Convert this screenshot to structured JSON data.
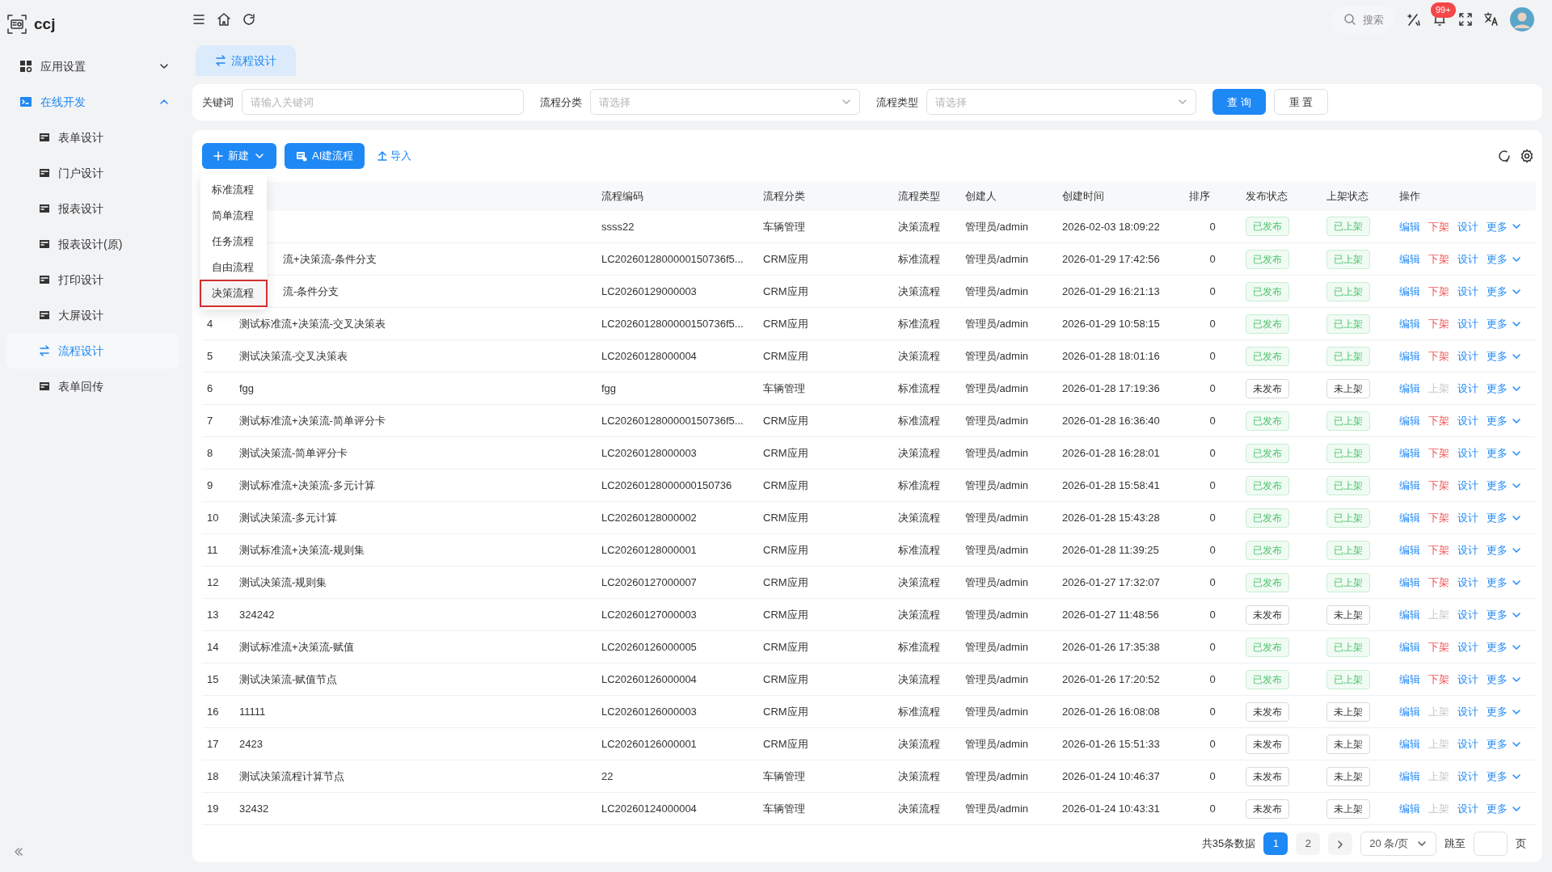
{
  "brand": {
    "name": "ccj"
  },
  "header": {
    "search_label": "搜索",
    "notification_badge": "99+"
  },
  "sidebar": {
    "items": [
      {
        "label": "应用设置",
        "expanded": false,
        "active": false
      },
      {
        "label": "在线开发",
        "expanded": true,
        "active": true,
        "children": [
          {
            "label": "表单设计",
            "selected": false
          },
          {
            "label": "门户设计",
            "selected": false
          },
          {
            "label": "报表设计",
            "selected": false
          },
          {
            "label": "报表设计(原)",
            "selected": false
          },
          {
            "label": "打印设计",
            "selected": false
          },
          {
            "label": "大屏设计",
            "selected": false
          },
          {
            "label": "流程设计",
            "selected": true
          },
          {
            "label": "表单回传",
            "selected": false
          }
        ]
      }
    ]
  },
  "tabs": [
    {
      "label": "流程设计",
      "selected": true
    }
  ],
  "filters": [
    {
      "kind": "text",
      "label": "关键词",
      "placeholder": "请输入关键词"
    },
    {
      "kind": "select",
      "label": "流程分类",
      "placeholder": "请选择"
    },
    {
      "kind": "select",
      "label": "流程类型",
      "placeholder": "请选择"
    }
  ],
  "filter_buttons": [
    {
      "label": "查 询",
      "kind": "primary"
    },
    {
      "label": "重 置",
      "kind": "default"
    }
  ],
  "toolbar": {
    "new_button": "新建",
    "ai_button": "AI建流程",
    "import_link": "导入"
  },
  "new_menu": [
    {
      "label": "标准流程",
      "highlighted": false
    },
    {
      "label": "简单流程",
      "highlighted": false
    },
    {
      "label": "任务流程",
      "highlighted": false
    },
    {
      "label": "自由流程",
      "highlighted": false
    },
    {
      "label": "决策流程",
      "highlighted": true
    }
  ],
  "table": {
    "columns": [
      "流程编码",
      "流程分类",
      "流程类型",
      "创建人",
      "创建时间",
      "排序",
      "发布状态",
      "上架状态",
      "操作"
    ],
    "rows": [
      {
        "code": "ssss22",
        "category": "车辆管理",
        "type": "决策流程",
        "creator": "管理员/admin",
        "created": "2026-02-03 18:09:22",
        "sort": "0",
        "publish": "已发布",
        "published": true,
        "listing": "已上架",
        "listed": true,
        "actions": [
          "编辑",
          "下架",
          "设计",
          "更多"
        ],
        "toggle_disabled": false
      },
      {
        "name": "流+决策流-条件分支",
        "code": "LC2026012800000150736f5...",
        "category": "CRM应用",
        "type": "标准流程",
        "creator": "管理员/admin",
        "created": "2026-01-29 17:42:56",
        "sort": "0",
        "publish": "已发布",
        "published": true,
        "listing": "已上架",
        "listed": true,
        "actions": [
          "编辑",
          "下架",
          "设计",
          "更多"
        ],
        "toggle_disabled": false
      },
      {
        "name": "流-条件分支",
        "code": "LC20260129000003",
        "category": "CRM应用",
        "type": "决策流程",
        "creator": "管理员/admin",
        "created": "2026-01-29 16:21:13",
        "sort": "0",
        "publish": "已发布",
        "published": true,
        "listing": "已上架",
        "listed": true,
        "actions": [
          "编辑",
          "下架",
          "设计",
          "更多"
        ],
        "toggle_disabled": false
      },
      {
        "index": "4",
        "name": "测试标准流+决策流-交叉决策表",
        "code": "LC2026012800000150736f5...",
        "category": "CRM应用",
        "type": "标准流程",
        "creator": "管理员/admin",
        "created": "2026-01-29 10:58:15",
        "sort": "0",
        "publish": "已发布",
        "published": true,
        "listing": "已上架",
        "listed": true,
        "actions": [
          "编辑",
          "下架",
          "设计",
          "更多"
        ],
        "toggle_disabled": false
      },
      {
        "index": "5",
        "name": "测试决策流-交叉决策表",
        "code": "LC20260128000004",
        "category": "CRM应用",
        "type": "决策流程",
        "creator": "管理员/admin",
        "created": "2026-01-28 18:01:16",
        "sort": "0",
        "publish": "已发布",
        "published": true,
        "listing": "已上架",
        "listed": true,
        "actions": [
          "编辑",
          "下架",
          "设计",
          "更多"
        ],
        "toggle_disabled": false
      },
      {
        "index": "6",
        "name": "fgg",
        "code": "fgg",
        "category": "车辆管理",
        "type": "标准流程",
        "creator": "管理员/admin",
        "created": "2026-01-28 17:19:36",
        "sort": "0",
        "publish": "未发布",
        "published": false,
        "listing": "未上架",
        "listed": false,
        "actions": [
          "编辑",
          "上架",
          "设计",
          "更多"
        ],
        "toggle_disabled": true
      },
      {
        "index": "7",
        "name": "测试标准流+决策流-简单评分卡",
        "code": "LC2026012800000150736f5...",
        "category": "CRM应用",
        "type": "标准流程",
        "creator": "管理员/admin",
        "created": "2026-01-28 16:36:40",
        "sort": "0",
        "publish": "已发布",
        "published": true,
        "listing": "已上架",
        "listed": true,
        "actions": [
          "编辑",
          "下架",
          "设计",
          "更多"
        ],
        "toggle_disabled": false
      },
      {
        "index": "8",
        "name": "测试决策流-简单评分卡",
        "code": "LC20260128000003",
        "category": "CRM应用",
        "type": "决策流程",
        "creator": "管理员/admin",
        "created": "2026-01-28 16:28:01",
        "sort": "0",
        "publish": "已发布",
        "published": true,
        "listing": "已上架",
        "listed": true,
        "actions": [
          "编辑",
          "下架",
          "设计",
          "更多"
        ],
        "toggle_disabled": false
      },
      {
        "index": "9",
        "name": "测试标准流+决策流-多元计算",
        "code": "LC20260128000000150736",
        "category": "CRM应用",
        "type": "标准流程",
        "creator": "管理员/admin",
        "created": "2026-01-28 15:58:41",
        "sort": "0",
        "publish": "已发布",
        "published": true,
        "listing": "已上架",
        "listed": true,
        "actions": [
          "编辑",
          "下架",
          "设计",
          "更多"
        ],
        "toggle_disabled": false
      },
      {
        "index": "10",
        "name": "测试决策流-多元计算",
        "code": "LC20260128000002",
        "category": "CRM应用",
        "type": "决策流程",
        "creator": "管理员/admin",
        "created": "2026-01-28 15:43:28",
        "sort": "0",
        "publish": "已发布",
        "published": true,
        "listing": "已上架",
        "listed": true,
        "actions": [
          "编辑",
          "下架",
          "设计",
          "更多"
        ],
        "toggle_disabled": false
      },
      {
        "index": "11",
        "name": "测试标准流+决策流-规则集",
        "code": "LC20260128000001",
        "category": "CRM应用",
        "type": "标准流程",
        "creator": "管理员/admin",
        "created": "2026-01-28 11:39:25",
        "sort": "0",
        "publish": "已发布",
        "published": true,
        "listing": "已上架",
        "listed": true,
        "actions": [
          "编辑",
          "下架",
          "设计",
          "更多"
        ],
        "toggle_disabled": false
      },
      {
        "index": "12",
        "name": "测试决策流-规则集",
        "code": "LC20260127000007",
        "category": "CRM应用",
        "type": "决策流程",
        "creator": "管理员/admin",
        "created": "2026-01-27 17:32:07",
        "sort": "0",
        "publish": "已发布",
        "published": true,
        "listing": "已上架",
        "listed": true,
        "actions": [
          "编辑",
          "下架",
          "设计",
          "更多"
        ],
        "toggle_disabled": false
      },
      {
        "index": "13",
        "name": "324242",
        "code": "LC20260127000003",
        "category": "CRM应用",
        "type": "决策流程",
        "creator": "管理员/admin",
        "created": "2026-01-27 11:48:56",
        "sort": "0",
        "publish": "未发布",
        "published": false,
        "listing": "未上架",
        "listed": false,
        "actions": [
          "编辑",
          "上架",
          "设计",
          "更多"
        ],
        "toggle_disabled": true
      },
      {
        "index": "14",
        "name": "测试标准流+决策流-赋值",
        "code": "LC20260126000005",
        "category": "CRM应用",
        "type": "标准流程",
        "creator": "管理员/admin",
        "created": "2026-01-26 17:35:38",
        "sort": "0",
        "publish": "已发布",
        "published": true,
        "listing": "已上架",
        "listed": true,
        "actions": [
          "编辑",
          "下架",
          "设计",
          "更多"
        ],
        "toggle_disabled": false
      },
      {
        "index": "15",
        "name": "测试决策流-赋值节点",
        "code": "LC20260126000004",
        "category": "CRM应用",
        "type": "决策流程",
        "creator": "管理员/admin",
        "created": "2026-01-26 17:20:52",
        "sort": "0",
        "publish": "已发布",
        "published": true,
        "listing": "已上架",
        "listed": true,
        "actions": [
          "编辑",
          "下架",
          "设计",
          "更多"
        ],
        "toggle_disabled": false
      },
      {
        "index": "16",
        "name": "11111",
        "code": "LC20260126000003",
        "category": "CRM应用",
        "type": "标准流程",
        "creator": "管理员/admin",
        "created": "2026-01-26 16:08:08",
        "sort": "0",
        "publish": "未发布",
        "published": false,
        "listing": "未上架",
        "listed": false,
        "actions": [
          "编辑",
          "上架",
          "设计",
          "更多"
        ],
        "toggle_disabled": true
      },
      {
        "index": "17",
        "name": "2423",
        "code": "LC20260126000001",
        "category": "CRM应用",
        "type": "决策流程",
        "creator": "管理员/admin",
        "created": "2026-01-26 15:51:33",
        "sort": "0",
        "publish": "未发布",
        "published": false,
        "listing": "未上架",
        "listed": false,
        "actions": [
          "编辑",
          "上架",
          "设计",
          "更多"
        ],
        "toggle_disabled": true
      },
      {
        "index": "18",
        "name": "测试决策流程计算节点",
        "code": "22",
        "category": "车辆管理",
        "type": "决策流程",
        "creator": "管理员/admin",
        "created": "2026-01-24 10:46:37",
        "sort": "0",
        "publish": "未发布",
        "published": false,
        "listing": "未上架",
        "listed": false,
        "actions": [
          "编辑",
          "上架",
          "设计",
          "更多"
        ],
        "toggle_disabled": true
      },
      {
        "index": "19",
        "name": "32432",
        "code": "LC20260124000004",
        "category": "车辆管理",
        "type": "决策流程",
        "creator": "管理员/admin",
        "created": "2026-01-24 10:43:31",
        "sort": "0",
        "publish": "未发布",
        "published": false,
        "listing": "未上架",
        "listed": false,
        "actions": [
          "编辑",
          "上架",
          "设计",
          "更多"
        ],
        "toggle_disabled": true
      }
    ]
  },
  "pagination": {
    "total": "共35条数据",
    "pages": [
      {
        "label": "1",
        "selected": true
      },
      {
        "label": "2",
        "selected": false
      }
    ],
    "page_size": "20 条/页",
    "jump_label": "跳至",
    "page_suffix": "页"
  }
}
